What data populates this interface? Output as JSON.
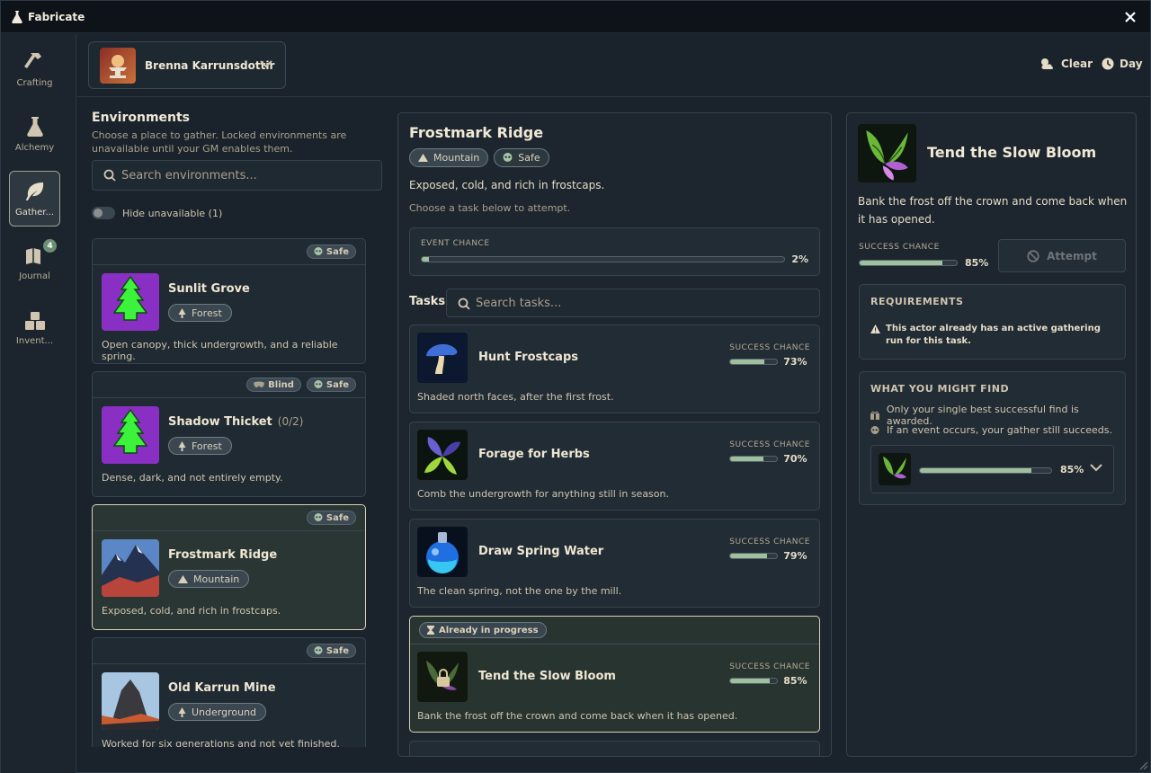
{
  "window": {
    "title": "Fabricate"
  },
  "rail": {
    "items": [
      {
        "label": "Crafting",
        "icon": "hammer-icon"
      },
      {
        "label": "Alchemy",
        "icon": "flask-icon"
      },
      {
        "label": "Gather...",
        "icon": "leaf-icon",
        "active": true
      },
      {
        "label": "Journal",
        "icon": "book-icon",
        "badge": "4"
      },
      {
        "label": "Invent...",
        "icon": "boxes-icon"
      }
    ]
  },
  "topbar": {
    "actor_name": "Brenna Karrunsdottir",
    "weather_label": "Clear",
    "time_label": "Day"
  },
  "environments": {
    "heading": "Environments",
    "description": "Choose a place to gather. Locked environments are unavailable until your GM enables them.",
    "search_placeholder": "Search environments...",
    "hide_unavailable_label": "Hide unavailable (1)",
    "items": [
      {
        "name": "Sunlit Grove",
        "count": "",
        "biome": "Forest",
        "description": "Open canopy, thick undergrowth, and a reliable spring.",
        "tags": [
          "Safe"
        ]
      },
      {
        "name": "Shadow Thicket",
        "count": "(0/2)",
        "biome": "Forest",
        "description": "Dense, dark, and not entirely empty.",
        "tags": [
          "Blind",
          "Safe"
        ]
      },
      {
        "name": "Frostmark Ridge",
        "count": "",
        "biome": "Mountain",
        "description": "Exposed, cold, and rich in frostcaps.",
        "tags": [
          "Safe"
        ],
        "selected": true
      },
      {
        "name": "Old Karrun Mine",
        "count": "",
        "biome": "Underground",
        "description": "Worked for six generations and not yet finished.",
        "tags": [
          "Safe"
        ]
      }
    ]
  },
  "detail": {
    "title": "Frostmark Ridge",
    "tags": [
      "Mountain",
      "Safe"
    ],
    "description": "Exposed, cold, and rich in frostcaps.",
    "hint": "Choose a task below to attempt.",
    "event_chance_label": "EVENT CHANCE",
    "event_chance_value": "2%",
    "event_chance_fraction": 0.02,
    "tasks_label": "Tasks",
    "tasks_search_placeholder": "Search tasks...",
    "success_label": "SUCCESS CHANCE",
    "tasks": [
      {
        "name": "Hunt Frostcaps",
        "description": "Shaded north faces, after the first frost.",
        "chance": "73%",
        "fraction": 0.73
      },
      {
        "name": "Forage for Herbs",
        "description": "Comb the undergrowth for anything still in season.",
        "chance": "70%",
        "fraction": 0.7
      },
      {
        "name": "Draw Spring Water",
        "description": "The clean spring, not the one by the mill.",
        "chance": "79%",
        "fraction": 0.79
      },
      {
        "name": "Tend the Slow Bloom",
        "description": "Bank the frost off the crown and come back when it has opened.",
        "chance": "85%",
        "fraction": 0.85,
        "status": "Already in progress"
      }
    ]
  },
  "selected_task": {
    "title": "Tend the Slow Bloom",
    "description": "Bank the frost off the crown and come back when it has opened.",
    "success_label": "SUCCESS CHANCE",
    "success_value": "85%",
    "success_fraction": 0.85,
    "attempt_label": "Attempt",
    "requirements_heading": "REQUIREMENTS",
    "requirement_text": "This actor already has an active gathering run for this task.",
    "find_heading": "WHAT YOU MIGHT FIND",
    "find_notes": [
      "Only your single best successful find is awarded.",
      "If an event occurs, your gather still succeeds."
    ],
    "loot_value": "85%",
    "loot_fraction": 0.85
  }
}
